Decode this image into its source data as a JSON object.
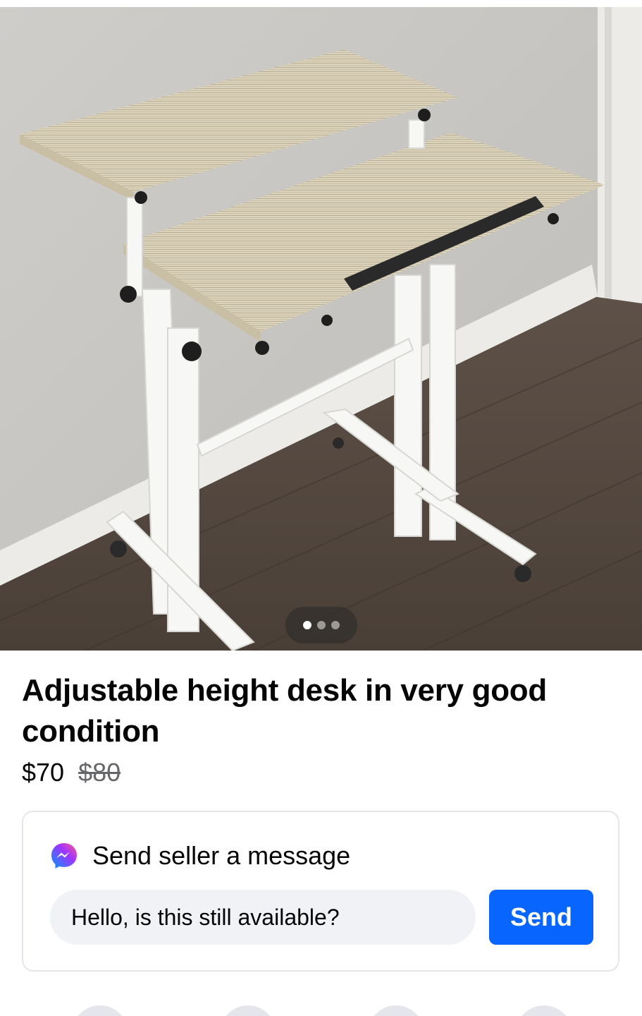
{
  "listing": {
    "title": "Adjustable height desk in very good condition",
    "price_current": "$70",
    "price_original": "$80",
    "photo_count": 3,
    "active_photo_index": 0
  },
  "message_box": {
    "header_label": "Send seller a message",
    "input_value": "Hello, is this still available?",
    "send_label": "Send"
  },
  "icons": {
    "messenger": "messenger-icon"
  },
  "colors": {
    "accent": "#0866ff",
    "input_bg": "#f0f2f5",
    "muted_text": "#65676b",
    "card_border": "#e4e6eb"
  }
}
